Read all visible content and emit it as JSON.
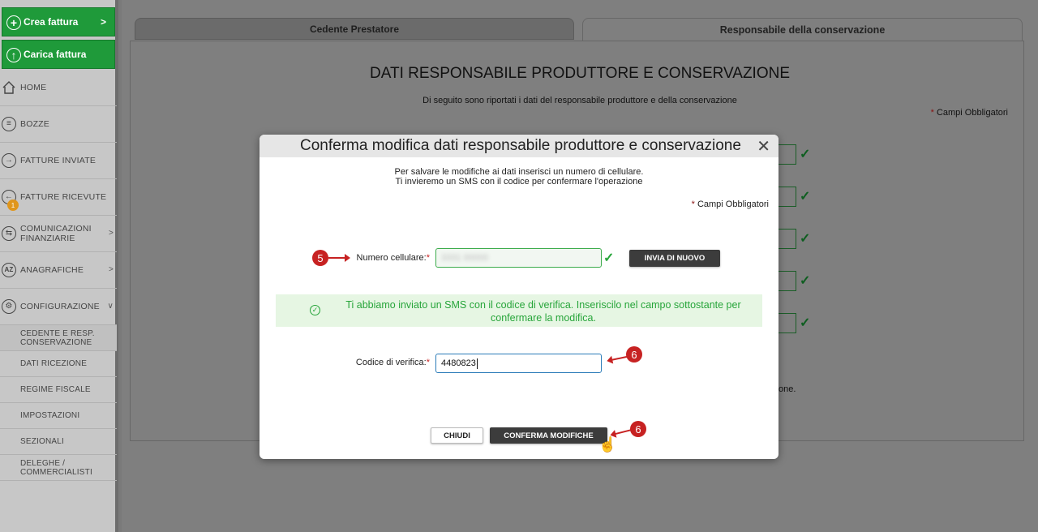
{
  "sidebar": {
    "crea_fattura": "Crea fattura",
    "carica_fattura": "Carica fattura",
    "items": [
      {
        "label": "HOME",
        "icon": "home-icon"
      },
      {
        "label": "BOZZE",
        "icon": "drafts-icon"
      },
      {
        "label": "FATTURE INVIATE",
        "icon": "sent-icon"
      },
      {
        "label": "FATTURE RICEVUTE",
        "icon": "received-icon"
      },
      {
        "label": "COMUNICAZIONI FINANZIARIE",
        "icon": "exchange-icon"
      },
      {
        "label": "ANAGRAFICHE",
        "icon": "az-icon"
      },
      {
        "label": "CONFIGURAZIONE",
        "icon": "gear-icon"
      }
    ],
    "badge": "1",
    "sub_items": [
      "CEDENTE E RESP. CONSERVAZIONE",
      "DATI RICEZIONE",
      "REGIME FISCALE",
      "IMPOSTAZIONI",
      "SEZIONALI",
      "DELEGHE / COMMERCIALISTI"
    ]
  },
  "tabs": {
    "tab1": "Cedente Prestatore",
    "tab2": "Responsabile della conservazione"
  },
  "page": {
    "title": "DATI RESPONSABILE PRODUTTORE E CONSERVAZIONE",
    "subtitle": "Di seguito sono riportati i dati del responsabile produttore e della conservazione",
    "required_note": "Campi Obbligatori",
    "partial_text": "one."
  },
  "modal": {
    "title": "Conferma modifica dati responsabile produttore e conservazione",
    "intro_line1": "Per salvare le modifiche ai dati inserisci un numero di cellulare.",
    "intro_line2": "Ti invieremo un SMS con il codice per confermare l'operazione",
    "required_note": "Campi Obbligatori",
    "phone_label": "Numero cellulare:",
    "phone_value": "3331 00000",
    "resend_button": "INVIA DI NUOVO",
    "alert_text": "Ti abbiamo inviato un SMS con il codice di verifica. Inseriscilo nel campo sottostante per confermare la modifica.",
    "code_label": "Codice di verifica:",
    "code_value": "4480823",
    "close_button": "CHIUDI",
    "confirm_button": "CONFERMA MODIFICHE"
  },
  "steps": {
    "step5": "5",
    "step6a": "6",
    "step6b": "6"
  },
  "colors": {
    "green": "#1f9a3a",
    "success": "#27a53a",
    "annotation": "#c72222",
    "dark_button": "#3c3c3c"
  }
}
